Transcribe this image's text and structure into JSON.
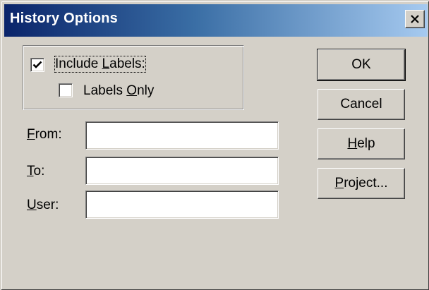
{
  "window": {
    "title": "History Options"
  },
  "options": {
    "include_labels": {
      "pre": "Include ",
      "accel": "L",
      "post": "abels:",
      "checked": true
    },
    "labels_only": {
      "pre": "Labels ",
      "accel": "O",
      "post": "nly",
      "checked": false
    }
  },
  "fields": {
    "from": {
      "accel": "F",
      "rest": "rom:",
      "value": ""
    },
    "to": {
      "accel": "T",
      "rest": "o:",
      "value": ""
    },
    "user": {
      "accel": "U",
      "rest": "ser:",
      "value": ""
    }
  },
  "buttons": {
    "ok": {
      "label": "OK"
    },
    "cancel": {
      "label": "Cancel"
    },
    "help": {
      "accel": "H",
      "rest": "elp"
    },
    "project": {
      "accel": "P",
      "rest": "roject..."
    }
  },
  "colors": {
    "title_start": "#0a246a",
    "title_end": "#a6caf0",
    "face": "#d4d0c8"
  }
}
